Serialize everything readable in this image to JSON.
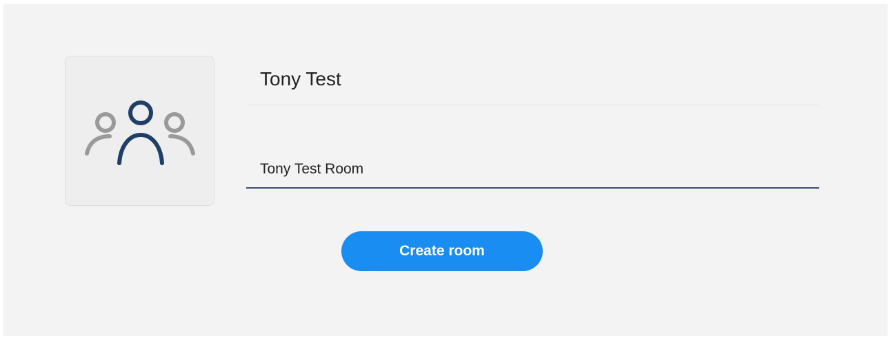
{
  "profile": {
    "avatar_icon": "group-users-icon",
    "name": "Tony Test"
  },
  "room": {
    "name_value": "Tony Test Room"
  },
  "actions": {
    "create_label": "Create room"
  },
  "colors": {
    "accent": "#1a8df2",
    "icon_primary": "#1f3f66",
    "icon_secondary": "#9a9a9a"
  }
}
